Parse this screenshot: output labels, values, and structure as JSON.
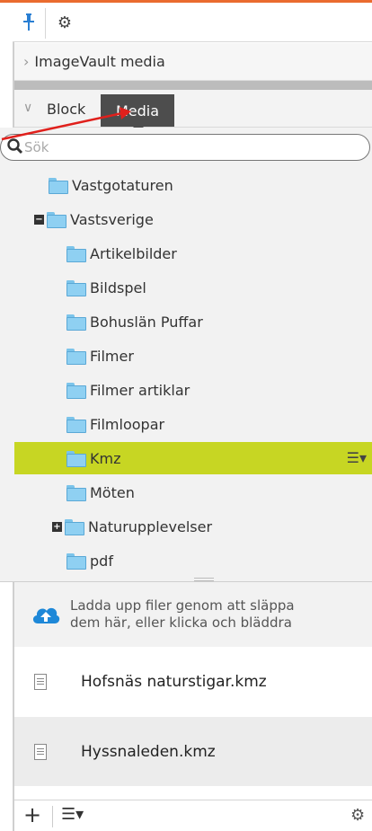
{
  "toolbar": {
    "pin_icon": "pin-icon",
    "settings_icon": "gear-icon"
  },
  "imagevault": {
    "label": "ImageVault media"
  },
  "tabs": {
    "block_label": "Block",
    "media_label": "Media"
  },
  "search": {
    "placeholder": "Sök"
  },
  "tree": {
    "items": [
      {
        "label": "Vastgotaturen"
      },
      {
        "label": "Vastsverige"
      },
      {
        "label": "Artikelbilder"
      },
      {
        "label": "Bildspel"
      },
      {
        "label": "Bohuslän Puffar"
      },
      {
        "label": "Filmer"
      },
      {
        "label": "Filmer artiklar"
      },
      {
        "label": "Filmloopar"
      },
      {
        "label": "Kmz"
      },
      {
        "label": "Möten"
      },
      {
        "label": "Naturupplevelser"
      },
      {
        "label": "pdf"
      }
    ],
    "selected_color": "#c7d623"
  },
  "upload": {
    "line1": "Ladda upp filer genom att släppa",
    "line2": "dem här, eller klicka och bläddra"
  },
  "files": [
    {
      "name": "Hofsnäs naturstigar.kmz"
    },
    {
      "name": "Hyssnaleden.kmz"
    }
  ],
  "colors": {
    "accent_orange": "#ea6b2f",
    "media_tab": "#4d4d4d",
    "pin_blue": "#2a7fd3",
    "cloud_blue": "#1e88d8",
    "arrow_red": "#e0201c"
  }
}
